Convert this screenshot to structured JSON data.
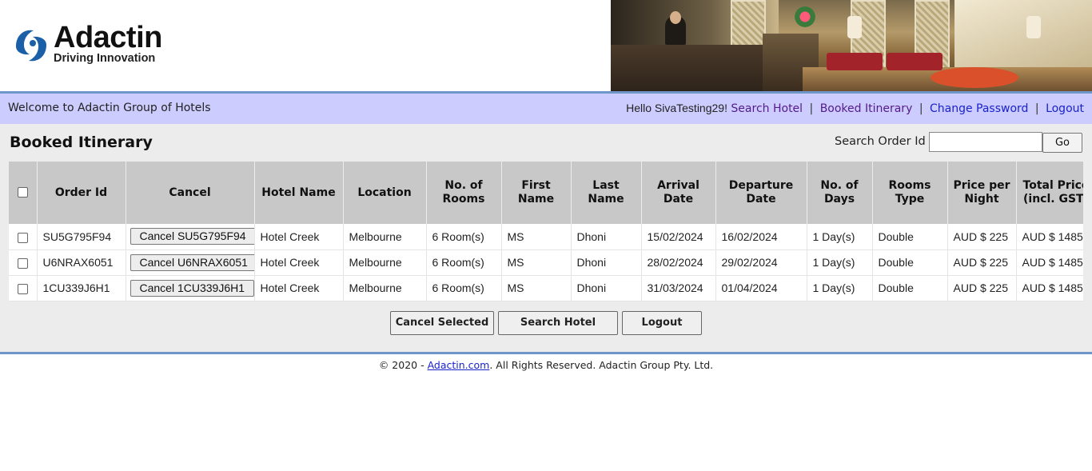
{
  "brand": {
    "name": "Adactin",
    "tagline": "Driving Innovation"
  },
  "nav": {
    "welcome": "Welcome to Adactin Group of Hotels",
    "hello": "Hello SivaTesting29!",
    "links": [
      "Search Hotel",
      "Booked Itinerary",
      "Change Password",
      "Logout"
    ],
    "separator": "|"
  },
  "page": {
    "title": "Booked Itinerary",
    "search_label": "Search Order Id",
    "search_value": "",
    "go_label": "Go"
  },
  "table": {
    "headers": [
      "Order Id",
      "Cancel",
      "Hotel Name",
      "Location",
      "No. of Rooms",
      "First Name",
      "Last Name",
      "Arrival Date",
      "Departure Date",
      "No. of Days",
      "Rooms Type",
      "Price per Night",
      "Total Price (incl. GST)"
    ],
    "rows": [
      {
        "order_id": "SU5G795F94",
        "cancel_label": "Cancel SU5G795F94",
        "hotel": "Hotel Creek",
        "location": "Melbourne",
        "rooms": "6 Room(s)",
        "first": "MS",
        "last": "Dhoni",
        "arrival": "15/02/2024",
        "departure": "16/02/2024",
        "days": "1 Day(s)",
        "type": "Double",
        "price": "AUD $ 225",
        "total": "AUD $ 1485"
      },
      {
        "order_id": "U6NRAX6051",
        "cancel_label": "Cancel U6NRAX6051",
        "hotel": "Hotel Creek",
        "location": "Melbourne",
        "rooms": "6 Room(s)",
        "first": "MS",
        "last": "Dhoni",
        "arrival": "28/02/2024",
        "departure": "29/02/2024",
        "days": "1 Day(s)",
        "type": "Double",
        "price": "AUD $ 225",
        "total": "AUD $ 1485"
      },
      {
        "order_id": "1CU339J6H1",
        "cancel_label": "Cancel 1CU339J6H1",
        "hotel": "Hotel Creek",
        "location": "Melbourne",
        "rooms": "6 Room(s)",
        "first": "MS",
        "last": "Dhoni",
        "arrival": "31/03/2024",
        "departure": "01/04/2024",
        "days": "1 Day(s)",
        "type": "Double",
        "price": "AUD $ 225",
        "total": "AUD $ 1485"
      }
    ]
  },
  "actions": {
    "cancel_selected": "Cancel Selected",
    "search_hotel": "Search Hotel",
    "logout": "Logout"
  },
  "footer": {
    "prefix": "© 2020 - ",
    "link": "Adactin.com",
    "suffix": ". All Rights Reserved. Adactin Group Pty. Ltd."
  },
  "colors": {
    "navbar_bg": "#ccccff",
    "accent_line": "#6f96c8",
    "content_bg": "#ececec",
    "header_cell_bg": "#c8c8c8"
  }
}
